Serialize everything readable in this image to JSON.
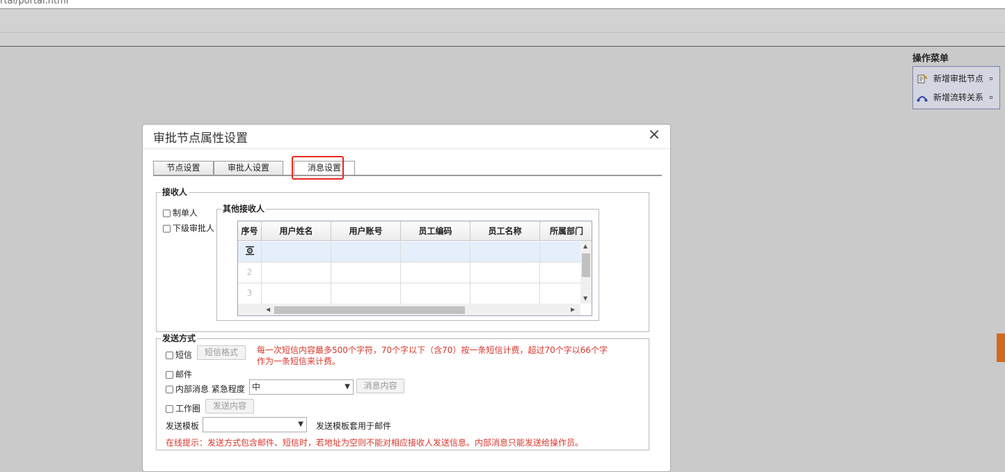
{
  "browser": {
    "url_fragment": "rtal/portal.html"
  },
  "operation_menu": {
    "title": "操作菜单",
    "items": [
      {
        "label": "新增审批节点",
        "icon": "add-node-icon"
      },
      {
        "label": "新增流转关系",
        "icon": "flow-link-icon"
      }
    ]
  },
  "dialog": {
    "title": "审批节点属性设置",
    "close_glyph": "×",
    "tabs": [
      {
        "label": "节点设置"
      },
      {
        "label": "审批人设置"
      },
      {
        "label": "消息设置",
        "active": true
      }
    ],
    "recipients": {
      "legend": "接收人",
      "creator": "制单人",
      "next_approver": "下级审批人",
      "others": {
        "legend": "其他接收人",
        "columns": [
          "序号",
          "用户姓名",
          "用户账号",
          "员工编码",
          "员工名称",
          "所属部门"
        ],
        "rows": [
          "",
          "2",
          "3"
        ]
      }
    },
    "send": {
      "legend": "发送方式",
      "sms_label": "短信",
      "sms_format_button": "短信格式",
      "sms_note_line1": "每一次短信内容最多500个字符，70个字以下（含70）按一条短信计费，超过70个字以66个字",
      "sms_note_line2": "作为一条短信来计费。",
      "email_label": "邮件",
      "internal_label": "内部消息",
      "urgency_label": "紧急程度",
      "urgency_value": "中",
      "message_content_button": "消息内容",
      "workcircle_label": "工作圈",
      "send_content_button": "发送内容",
      "template_label": "发送模板",
      "template_value": "",
      "template_note": "发送模板套用于邮件",
      "tip": "在线提示：发送方式包含邮件、短信时，若地址为空则不能对相应接收人发送信息。内部消息只能发送给操作员。"
    }
  },
  "colors": {
    "highlight": "#e8261d",
    "warning": "#d9362b",
    "menu_bg": "#d3d5e0",
    "side_tab": "#d2691e"
  }
}
